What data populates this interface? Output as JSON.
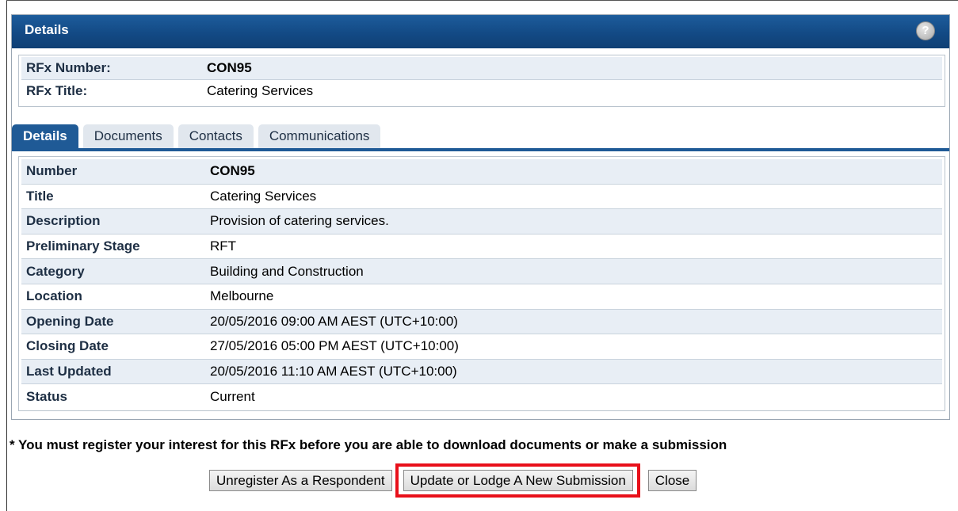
{
  "panel": {
    "title": "Details",
    "help_icon": "help-question-icon"
  },
  "summary": [
    {
      "key": "RFx Number:",
      "value": "CON95",
      "value_bold": true
    },
    {
      "key": "RFx Title:",
      "value": "Catering Services",
      "value_bold": false
    }
  ],
  "tabs": [
    {
      "label": "Details",
      "active": true
    },
    {
      "label": "Documents",
      "active": false
    },
    {
      "label": "Contacts",
      "active": false
    },
    {
      "label": "Communications",
      "active": false
    }
  ],
  "details": [
    {
      "key": "Number",
      "value": "CON95",
      "value_bold": true
    },
    {
      "key": "Title",
      "value": "Catering Services",
      "value_bold": false
    },
    {
      "key": "Description",
      "value": "Provision of catering services.",
      "value_bold": false
    },
    {
      "key": "Preliminary Stage",
      "value": "RFT",
      "value_bold": false
    },
    {
      "key": "Category",
      "value": "Building and Construction",
      "value_bold": false
    },
    {
      "key": "Location",
      "value": "Melbourne",
      "value_bold": false
    },
    {
      "key": "Opening Date",
      "value": "20/05/2016 09:00 AM AEST (UTC+10:00)",
      "value_bold": false
    },
    {
      "key": "Closing Date",
      "value": "27/05/2016 05:00 PM AEST (UTC+10:00)",
      "value_bold": false
    },
    {
      "key": "Last Updated",
      "value": "20/05/2016 11:10 AM AEST (UTC+10:00)",
      "value_bold": false
    },
    {
      "key": "Status",
      "value": "Current",
      "value_bold": false
    }
  ],
  "notice": "* You must register your interest for this RFx before you are able to download documents or make a submission",
  "buttons": {
    "unregister": "Unregister As a Respondent",
    "update": "Update or Lodge A New Submission",
    "close": "Close"
  },
  "colors": {
    "header_blue": "#134a85",
    "highlight_red": "#e8101a",
    "row_alt": "#e8eef5"
  }
}
